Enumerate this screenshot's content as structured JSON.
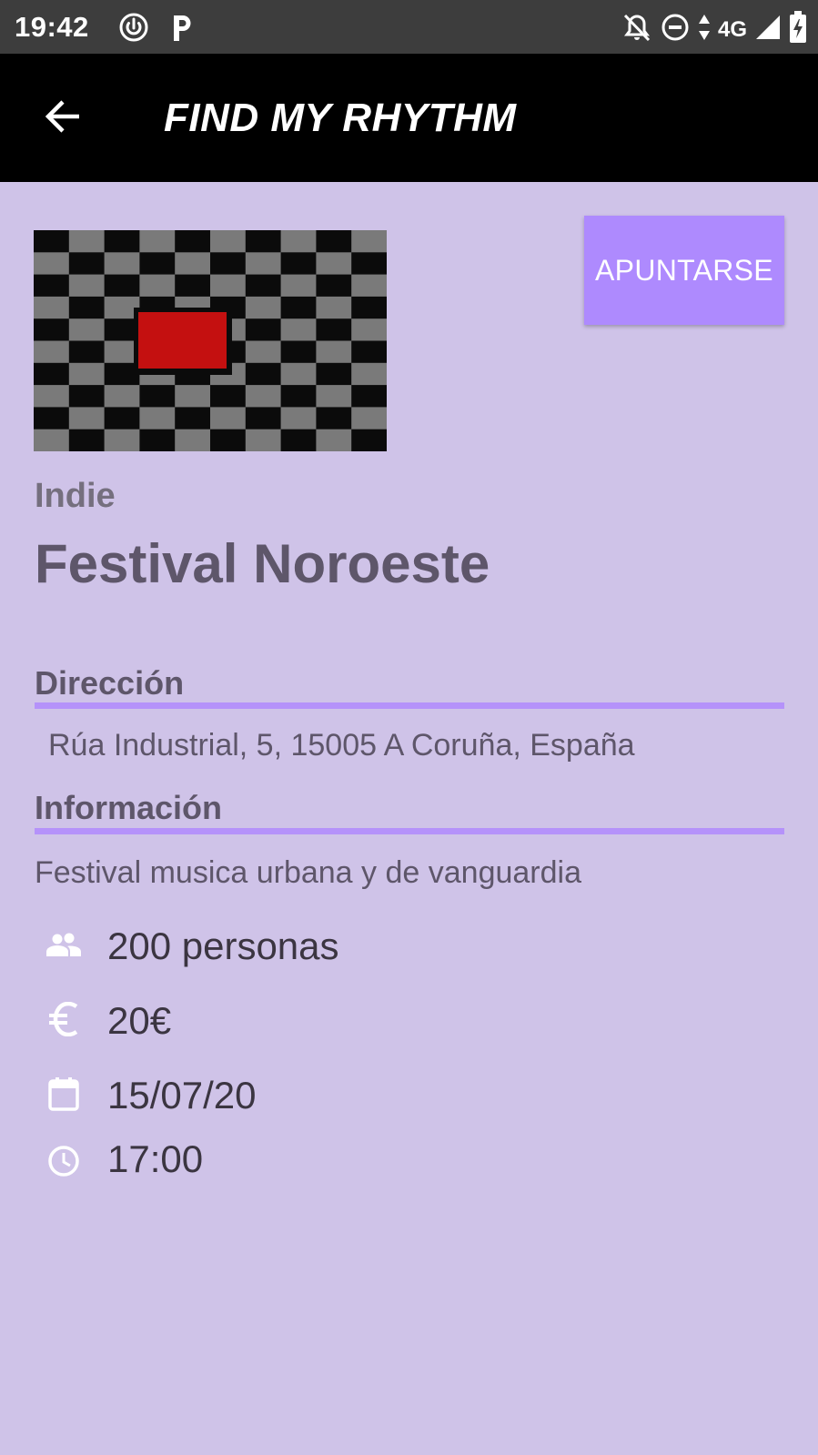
{
  "status_bar": {
    "time": "19:42",
    "network": "4G"
  },
  "app_bar": {
    "title": "FIND MY RHYTHM"
  },
  "event": {
    "genre": "Indie",
    "name": "Festival Noroeste",
    "join_label": "APUNTARSE"
  },
  "sections": {
    "address_heading": "Dirección",
    "address": "Rúa Industrial, 5, 15005 A Coruña, España",
    "info_heading": "Información",
    "description": "Festival musica urbana y de vanguardia"
  },
  "details": {
    "capacity": "200 personas",
    "price": "20€",
    "date": "15/07/20",
    "time": "17:00"
  },
  "colors": {
    "background": "#cfc3e8",
    "accent": "#ae8afe",
    "divider": "#b592fa",
    "app_bar": "#000000"
  },
  "icons": {
    "back": "arrow-back-icon",
    "capacity": "people-icon",
    "price": "euro-icon",
    "date": "calendar-icon",
    "time": "clock-icon"
  }
}
